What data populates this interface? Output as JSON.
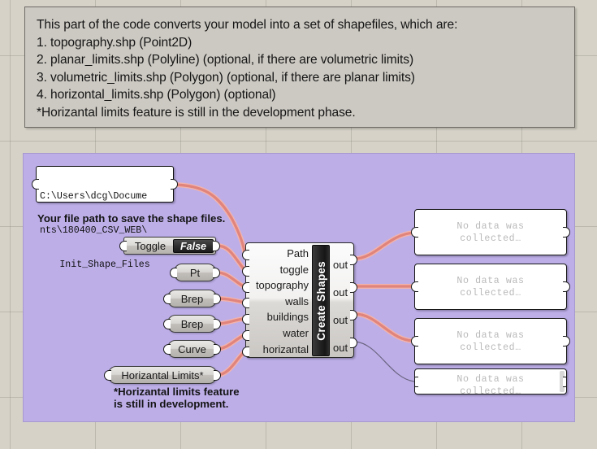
{
  "canvas": {
    "background_color": "#d6d2c8",
    "grid_color": "#787369",
    "group_color": "#bdaee8"
  },
  "description_panel": {
    "lines": [
      "This part of the code converts your model into a set of shapefiles, which are:",
      "1. topography.shp (Point2D)",
      "2. planar_limits.shp (Polyline) (optional, if there are volumetric limits)",
      "3. volumetric_limits.shp  (Polygon) (optional, if there are planar limits)",
      "4. horizontal_limits.shp (Polygon) (optional)",
      "*Horizantal limits feature is still in the development phase."
    ]
  },
  "path_node": {
    "line1": "C:\\Users\\dcg\\Docume",
    "line2": "nts\\180400_CSV_WEB\\",
    "line3": "Init_Shape_Files",
    "caption": "Your file path to save the shape files."
  },
  "params": [
    {
      "id": "toggle",
      "label": "Toggle",
      "value": "False"
    },
    {
      "id": "pt",
      "label": "Pt"
    },
    {
      "id": "brep1",
      "label": "Brep"
    },
    {
      "id": "brep2",
      "label": "Brep"
    },
    {
      "id": "curve",
      "label": "Curve"
    },
    {
      "id": "horizantal_limits",
      "label": "Horizantal Limits*"
    }
  ],
  "horizantal_caption": {
    "line1": "*Horizantal limits feature",
    "line2": "is still in development."
  },
  "component": {
    "title": "Create Shapes",
    "inputs": [
      "Path",
      "toggle",
      "topography",
      "walls",
      "buildings",
      "water",
      "horizantal"
    ],
    "outputs": [
      "out",
      "out",
      "out",
      "out"
    ]
  },
  "output_panels": [
    {
      "message": "No data was\ncollected…"
    },
    {
      "message": "No data was\ncollected…"
    },
    {
      "message": "No data was\ncollected…"
    },
    {
      "message": "No data was\ncollected…"
    }
  ],
  "wire_colors": {
    "data_wire": "#e0847c",
    "empty_wire": "#6b6580"
  }
}
